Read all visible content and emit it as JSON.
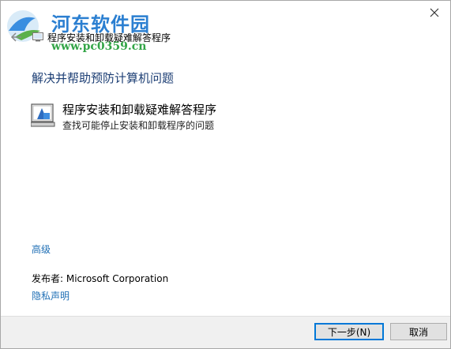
{
  "window": {
    "title": "程序安装和卸载疑难解答程序"
  },
  "watermark": {
    "name": "河东软件园",
    "url": "www.pc0359.cn"
  },
  "main": {
    "heading": "解决并帮助预防计算机问题",
    "option": {
      "title": "程序安装和卸载疑难解答程序",
      "description": "查找可能停止安装和卸载程序的问题"
    },
    "advanced_link": "高级",
    "publisher": "发布者:  Microsoft Corporation",
    "privacy_link": "隐私声明"
  },
  "footer": {
    "next_label": "下一步(N)",
    "cancel_label": "取消"
  },
  "colors": {
    "heading": "#1c3e74",
    "link": "#1f6fb5",
    "footer_bg": "#f0f0f0"
  }
}
